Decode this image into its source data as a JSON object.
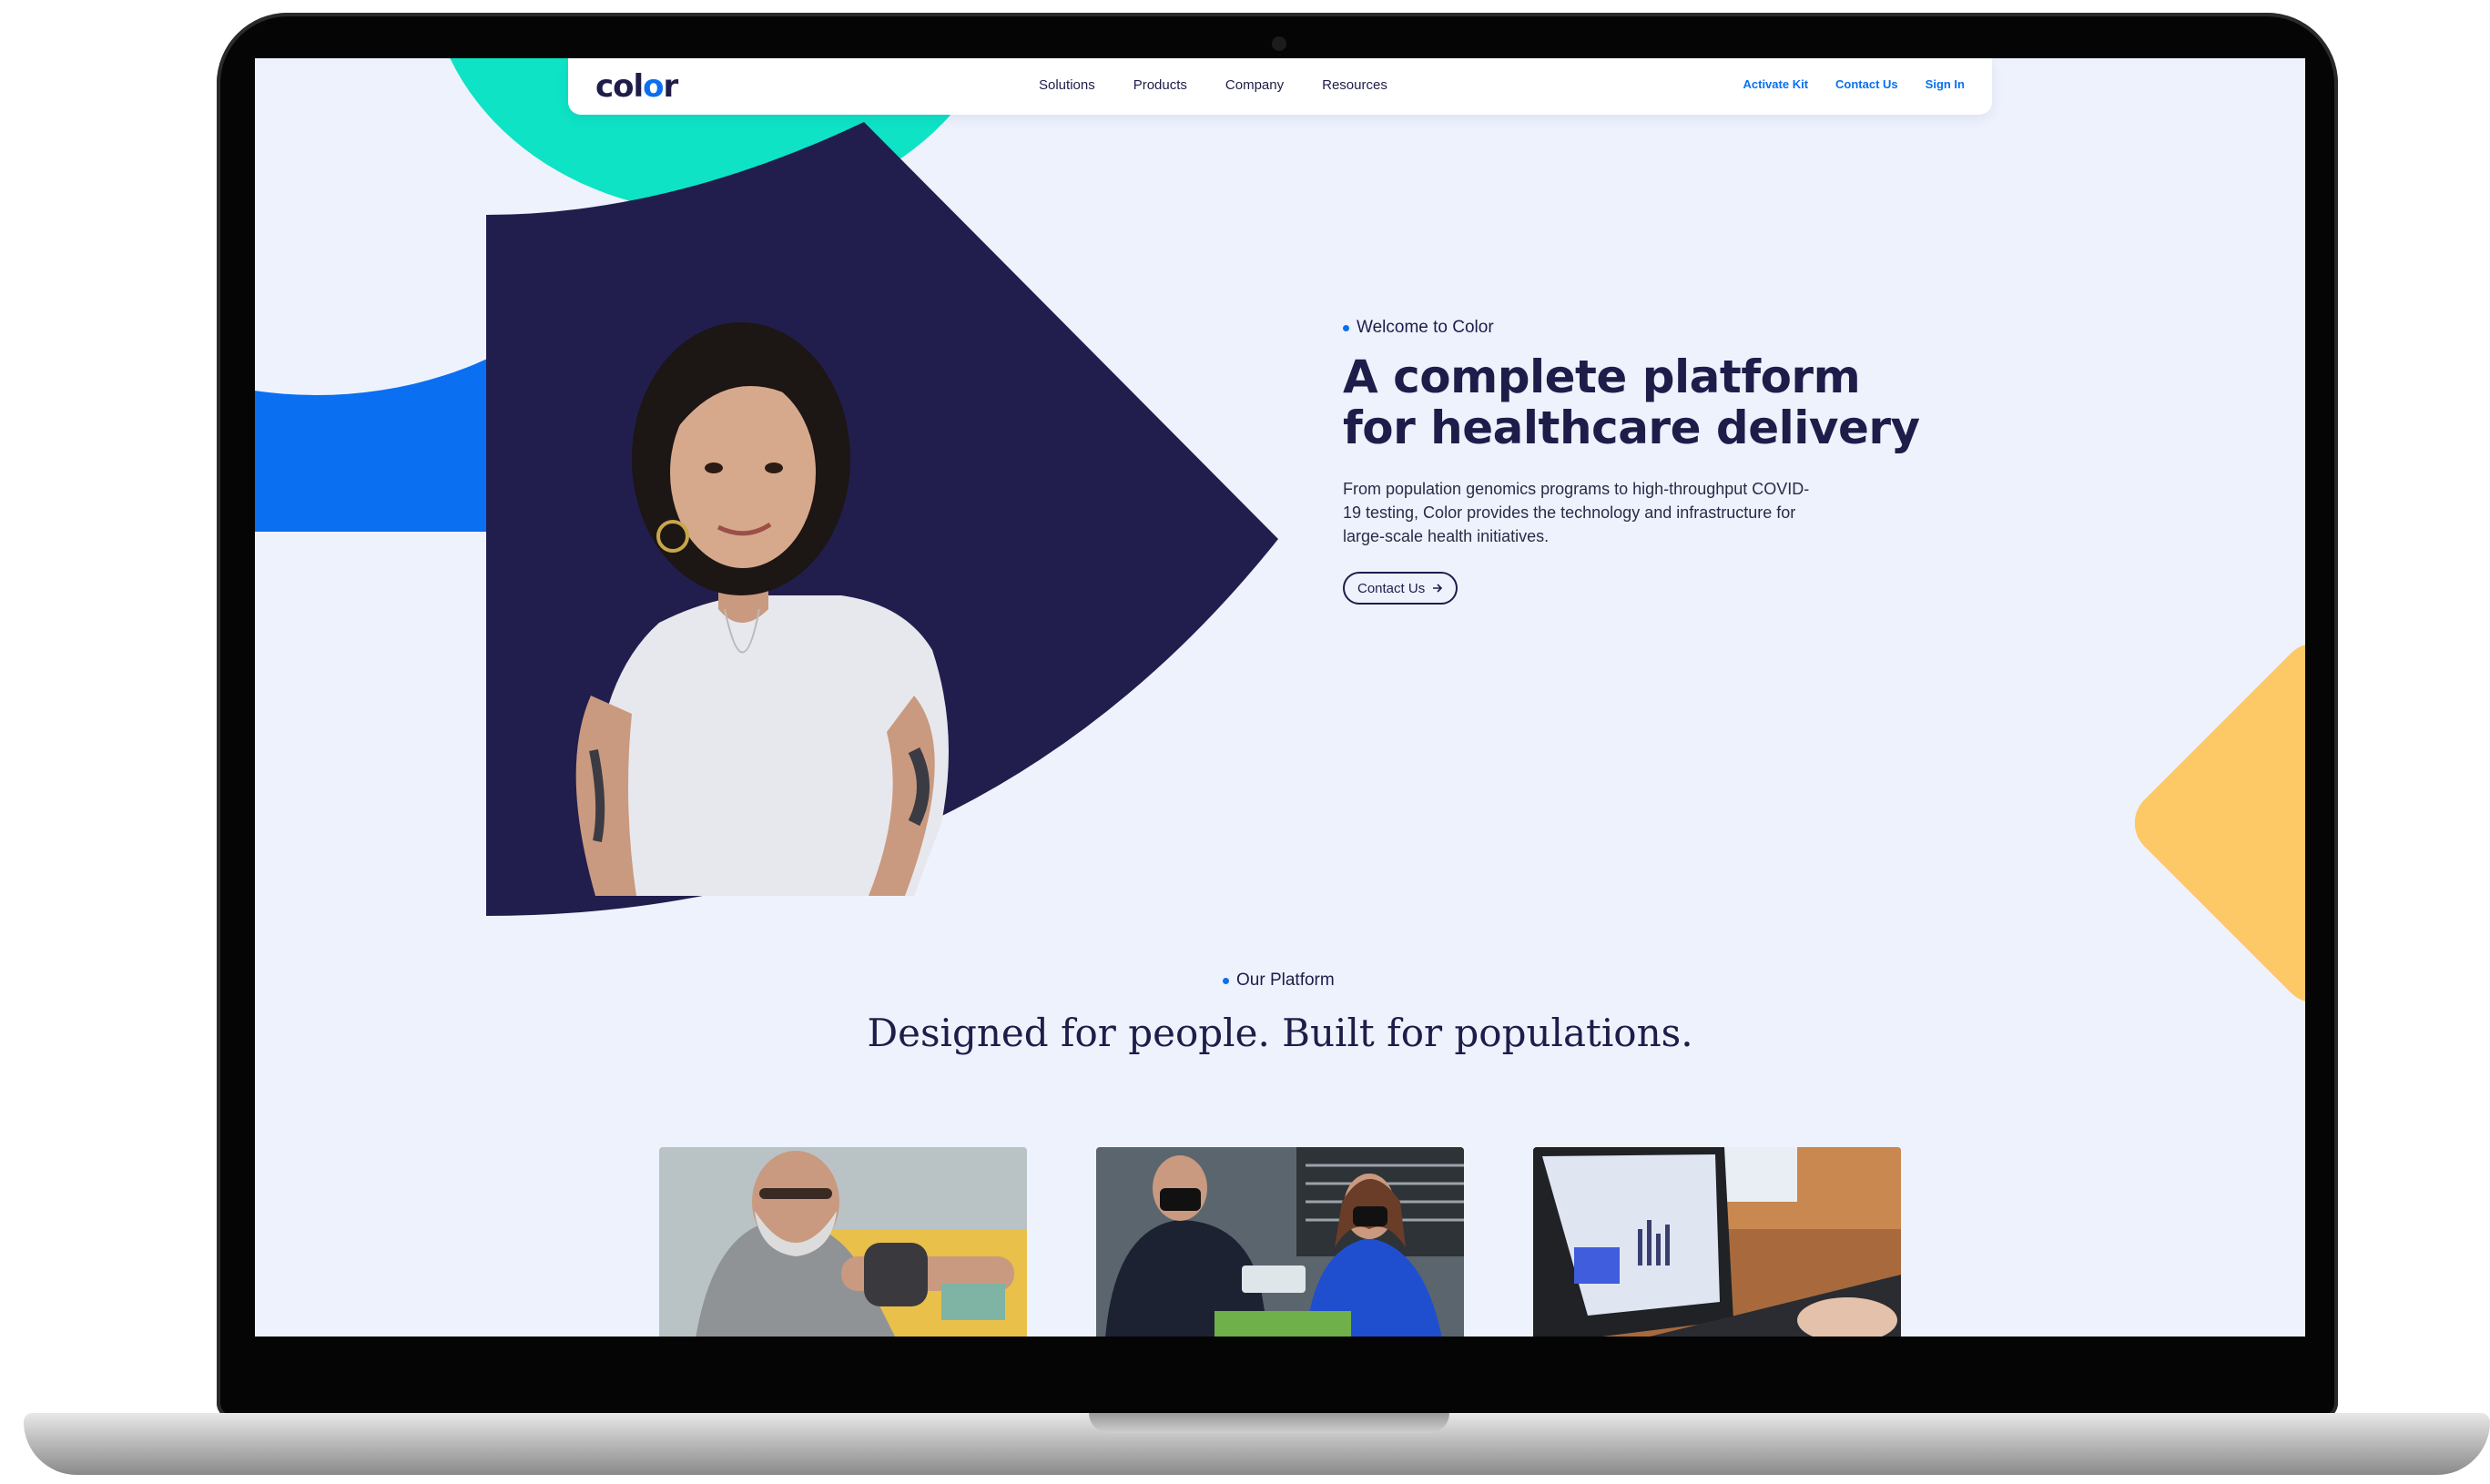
{
  "nav": {
    "logo": "color",
    "center_links": [
      "Solutions",
      "Products",
      "Company",
      "Resources"
    ],
    "right_links": [
      "Activate Kit",
      "Contact Us",
      "Sign In"
    ]
  },
  "hero": {
    "eyebrow": "Welcome to Color",
    "title_line1": "A complete platform",
    "title_line2": "for healthcare delivery",
    "body": "From population genomics programs to high-throughput COVID-19 testing, Color provides the technology and infrastructure for large-scale health initiatives.",
    "cta_label": "Contact Us",
    "cta_icon": "arrow-right-icon"
  },
  "platform": {
    "eyebrow": "Our Platform",
    "title": "Designed for people. Built for populations."
  },
  "colors": {
    "navy": "#1e1d4a",
    "blue": "#0a6ff0",
    "teal": "#0ee3c6",
    "yellow": "#fdc866",
    "background": "#eef2fd"
  }
}
